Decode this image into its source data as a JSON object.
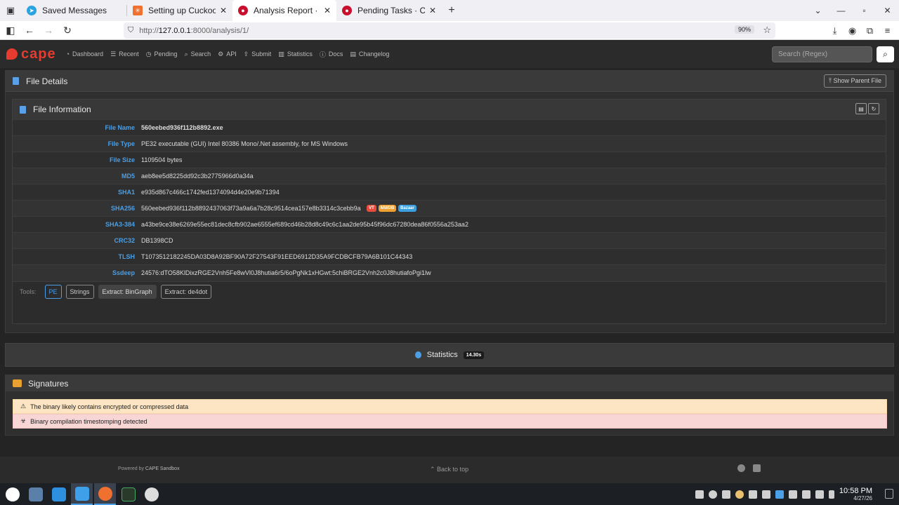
{
  "browser": {
    "tabs": [
      {
        "label": "Saved Messages",
        "active": false
      },
      {
        "label": "Setting up Cuckoo sandbo",
        "active": false
      },
      {
        "label": "Analysis Report · CAPE San",
        "active": true
      },
      {
        "label": "Pending Tasks · CAPE Sand",
        "active": false
      }
    ],
    "url_scheme": "http://",
    "url_host": "127.0.0.1",
    "url_rest": ":8000/analysis/1/",
    "zoom": "90%"
  },
  "cape_nav": {
    "logo": "cape",
    "items": [
      "Dashboard",
      "Recent",
      "Pending",
      "Search",
      "API",
      "Submit",
      "Statistics",
      "Docs",
      "Changelog"
    ],
    "search_placeholder": "Search (Regex)"
  },
  "file_details": {
    "title": "File Details",
    "show_parent": "Show Parent File",
    "info_title": "File Information",
    "rows": [
      {
        "key": "File Name",
        "value": "560eebed936f112b8892.exe"
      },
      {
        "key": "File Type",
        "value": "PE32 executable (GUI) Intel 80386 Mono/.Net assembly, for MS Windows"
      },
      {
        "key": "File Size",
        "value": "1109504 bytes"
      },
      {
        "key": "MD5",
        "value": "aeb8ee5d8225dd92c3b2775966d0a34a"
      },
      {
        "key": "SHA1",
        "value": "e935d867c466c1742fed1374094d4e20e9b71394"
      },
      {
        "key": "SHA256",
        "value": "560eebed936f112b8892437063f73a9a6a7b28c9514cea157e8b3314c3cebb9a"
      },
      {
        "key": "SHA3-384",
        "value": "a43be9ce38e6269e55ec81dec8cfb902ae6555ef689cd46b28d8c49c6c1aa2de95b45f96dc67280dea86f0556a253aa2"
      },
      {
        "key": "CRC32",
        "value": "DB1398CD"
      },
      {
        "key": "TLSH",
        "value": "T1073512182245DA03D8A92BF90A72F27543F91EED6912D35A9FCDBCFB79A6B101C44343"
      },
      {
        "key": "Ssdeep",
        "value": "24576:dTO58KlDixzRGE2Vnh5Fe8wVl0J8hutia6r5/6oPgNk1xHGwt:5chiBRGE2Vnh2c0J8hutiafoPgi1lw"
      }
    ],
    "sha256_badges": [
      {
        "label": "VT",
        "color": "#e84c3d"
      },
      {
        "label": "MWDB",
        "color": "#f0a030"
      },
      {
        "label": "Bazaar",
        "color": "#3aa0e0"
      }
    ],
    "tools_label": "Tools:",
    "tools": [
      "PE",
      "Strings",
      "Extract: BinGraph",
      "Extract: de4dot"
    ]
  },
  "statistics": {
    "label": "Statistics",
    "time": "14.30s"
  },
  "signatures": {
    "title": "Signatures",
    "items": [
      "The binary likely contains encrypted or compressed data",
      "Binary compilation timestomping detected"
    ]
  },
  "footer": {
    "powered_prefix": "Powered by",
    "powered_link": "CAPE Sandbox",
    "back_to_top": "Back to top"
  },
  "taskbar": {
    "time": "10:58 PM",
    "date": "4/27/26"
  }
}
